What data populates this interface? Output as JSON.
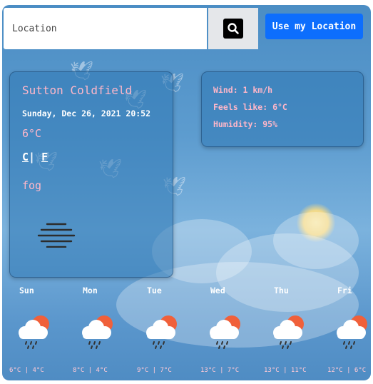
{
  "search": {
    "placeholder": "Location",
    "value": ""
  },
  "buttons": {
    "use_location": "Use my Location"
  },
  "current": {
    "city": "Sutton Coldfield",
    "datetime": "Sunday, Dec 26, 2021 20:52",
    "temperature": "6°C",
    "unit_c": "C",
    "unit_sep": "|",
    "unit_f": "F",
    "condition": "fog",
    "condition_icon": "fog-icon"
  },
  "details": {
    "wind": "Wind: 1 km/h",
    "feels_like": "Feels like: 6°C",
    "humidity": "Humidity: 95%"
  },
  "forecast": [
    {
      "day": "Sun",
      "range": "6°C | 4°C",
      "icon": "cloud-sun-rain-icon"
    },
    {
      "day": "Mon",
      "range": "8°C | 4°C",
      "icon": "cloud-sun-rain-icon"
    },
    {
      "day": "Tue",
      "range": "9°C | 7°C",
      "icon": "cloud-sun-rain-icon"
    },
    {
      "day": "Wed",
      "range": "13°C | 7°C",
      "icon": "cloud-sun-rain-icon"
    },
    {
      "day": "Thu",
      "range": "13°C | 11°C",
      "icon": "cloud-sun-rain-icon"
    },
    {
      "day": "Fri",
      "range": "12°C | 6°C",
      "icon": "cloud-sun-rain-icon"
    }
  ],
  "colors": {
    "accent": "#0d6efd",
    "highlight_text": "#ffb7c9"
  }
}
